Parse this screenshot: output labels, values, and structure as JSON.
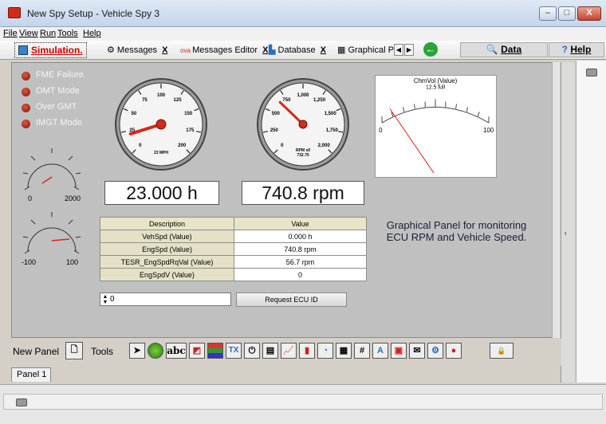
{
  "window": {
    "title": "New Spy Setup - Vehicle Spy 3",
    "minimize": "–",
    "maximize": "□",
    "close": "X"
  },
  "menu": [
    "File",
    "View",
    "Run",
    "Tools",
    "Help"
  ],
  "tabs": {
    "simulation": "Simulation.",
    "items": [
      {
        "label": "Messages",
        "close": "X"
      },
      {
        "label": "Messages Editor",
        "close": "X"
      },
      {
        "label": "Database",
        "close": "X"
      },
      {
        "label": "Graphical P"
      }
    ],
    "data_label": "Data",
    "help_label": "Help"
  },
  "leds": [
    {
      "label": "FME Failure"
    },
    {
      "label": "OMT Mode"
    },
    {
      "label": "Over GMT"
    },
    {
      "label": "IMGT Mode"
    }
  ],
  "knob1": {
    "min": "0",
    "max": "2000"
  },
  "knob2": {
    "min": "-100",
    "max": "100"
  },
  "gauge_speed": {
    "ticks": [
      "0",
      "25",
      "50",
      "75",
      "100",
      "125",
      "150",
      "175",
      "200"
    ],
    "unit": "23 MPH",
    "needle_value": 23,
    "max": 225
  },
  "gauge_rpm": {
    "ticks": [
      "0",
      "250",
      "500",
      "750",
      "1,000",
      "1,250",
      "1,500",
      "1,750",
      "2,000"
    ],
    "unit_line1": "RPM x0",
    "unit_line2": "732.75",
    "needle_value": 740.8,
    "max": 2250
  },
  "readouts": {
    "speed": "23.000 h",
    "rpm": "740.8 rpm"
  },
  "chart": {
    "title": "ChmVol (Value)",
    "subtitle": "12.5 full",
    "min_label": "0",
    "max_label": "100",
    "needle_fraction": 0.18
  },
  "table": {
    "headers": [
      "Description",
      "Value"
    ],
    "rows": [
      [
        "VehSpd (Value)",
        "0.000 h"
      ],
      [
        "EngSpd (Value)",
        "740.8 rpm"
      ],
      [
        "TESR_EngSpdRqVal (Value)",
        "56.7 rpm"
      ],
      [
        "EngSpdV (Value)",
        "0"
      ]
    ]
  },
  "caption": "Graphical Panel for monitoring ECU RPM and Vehicle Speed.",
  "spinner_value": "0",
  "request_button": "Request ECU ID",
  "toolbar": {
    "new_panel": "New Panel",
    "tools": "Tools",
    "abc": "abc",
    "tx": "TX",
    "hash": "#",
    "a": "A"
  },
  "panel_tab": "Panel 1",
  "colors": {
    "led": "#c0392b",
    "needle": "#d12b1a",
    "canvas": "#c0c0c0"
  }
}
